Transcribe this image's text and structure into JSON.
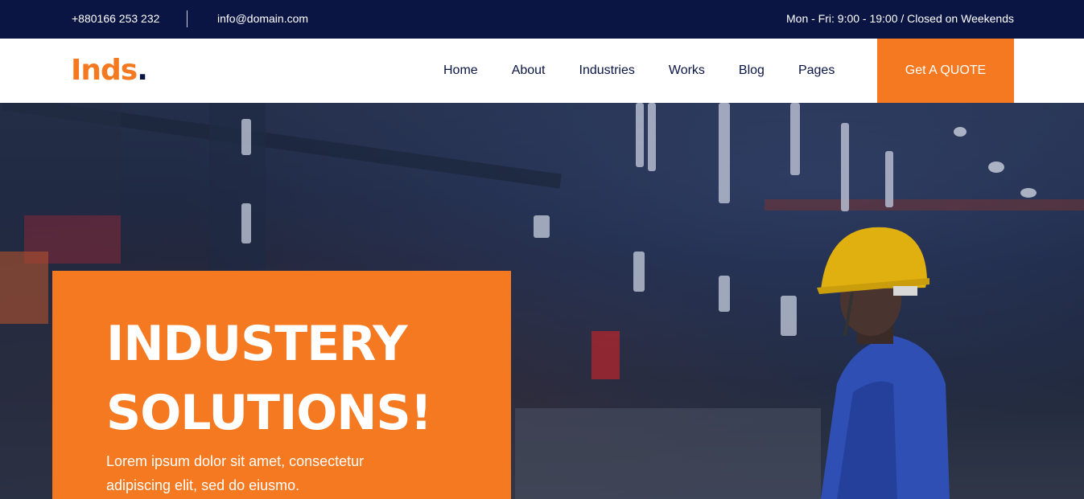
{
  "topbar": {
    "phone": "+880166 253 232",
    "email": "info@domain.com",
    "hours": "Mon - Fri: 9:00 - 19:00 / Closed on Weekends"
  },
  "header": {
    "logo_text": "Inds",
    "logo_dot": ".",
    "nav": [
      {
        "label": "Home"
      },
      {
        "label": "About"
      },
      {
        "label": "Industries"
      },
      {
        "label": "Works"
      },
      {
        "label": "Blog"
      },
      {
        "label": "Pages"
      }
    ],
    "quote_button": "Get A QUOTE"
  },
  "hero": {
    "title_line1": "INDUSTERY",
    "title_line2": "SOLUTIONS!",
    "description": "Lorem ipsum dolor sit amet, consectetur adipiscing elit, sed do eiusmo."
  },
  "colors": {
    "accent": "#f47920",
    "navy": "#0a1543",
    "white": "#ffffff"
  }
}
